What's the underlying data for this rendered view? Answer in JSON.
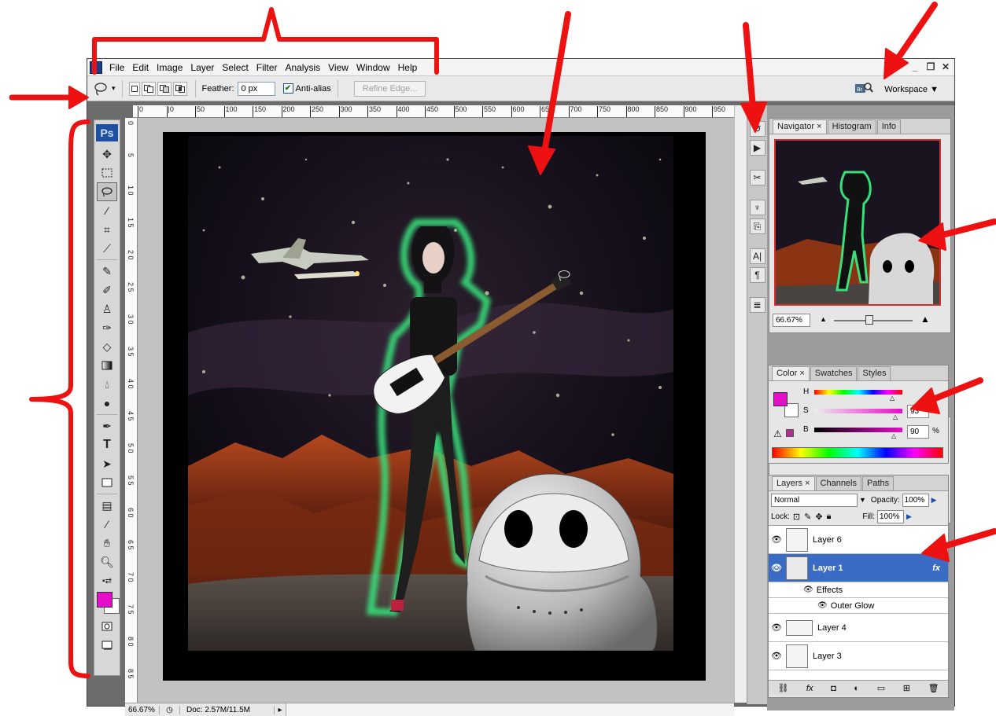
{
  "app": {
    "logo": "Ps"
  },
  "menu": [
    "File",
    "Edit",
    "Image",
    "Layer",
    "Select",
    "Filter",
    "Analysis",
    "View",
    "Window",
    "Help"
  ],
  "window_controls": {
    "minimize": "_",
    "restore": "❐",
    "close": "✕"
  },
  "options": {
    "tool_icon": "lasso-icon",
    "feather_label": "Feather:",
    "feather_value": "0 px",
    "antialias_label": "Anti-alias",
    "antialias_checked": true,
    "refine_edge_label": "Refine Edge...",
    "workspace_label": "Workspace ▼"
  },
  "ruler_top": [
    "0",
    "|0",
    "50",
    "100",
    "150",
    "200",
    "250",
    "300",
    "350",
    "400",
    "450",
    "500",
    "550",
    "600",
    "650",
    "700",
    "750",
    "800",
    "850",
    "900",
    "950"
  ],
  "ruler_left": [
    "0",
    "5",
    "1 0",
    "1 5",
    "2 0",
    "2 5",
    "3 0",
    "3 5",
    "4 0",
    "4 5",
    "5 0",
    "5 5",
    "6 0",
    "6 5",
    "7 0",
    "7 5",
    "8 0",
    "8 5"
  ],
  "status": {
    "zoom": "66.67%",
    "doc": "Doc: 2.57M/11.5M"
  },
  "navigator": {
    "tabs": [
      "Navigator",
      "Histogram",
      "Info"
    ],
    "zoom": "66.67%"
  },
  "color": {
    "tabs": [
      "Color",
      "Swatches",
      "Styles"
    ],
    "h_label": "H",
    "s_label": "S",
    "b_label": "B",
    "s_value": "93",
    "b_value": "90",
    "pct": "%",
    "foreground": "#e40fc8"
  },
  "layers": {
    "tabs": [
      "Layers",
      "Channels",
      "Paths"
    ],
    "blend_mode": "Normal",
    "opacity_label": "Opacity:",
    "opacity_value": "100%",
    "lock_label": "Lock:",
    "fill_label": "Fill:",
    "fill_value": "100%",
    "items": [
      {
        "name": "Layer 6",
        "selected": false
      },
      {
        "name": "Layer 1",
        "selected": true,
        "fx": "fx"
      },
      {
        "name": "Effects",
        "selected": false
      },
      {
        "name": "Outer Glow",
        "selected": false
      },
      {
        "name": "Layer 4",
        "selected": false
      },
      {
        "name": "Layer 3",
        "selected": false
      }
    ]
  },
  "colors": {
    "annotation_red": "#ee1111",
    "ps_blue": "#1e4fa0",
    "selection_blue": "#3a6cc6"
  }
}
